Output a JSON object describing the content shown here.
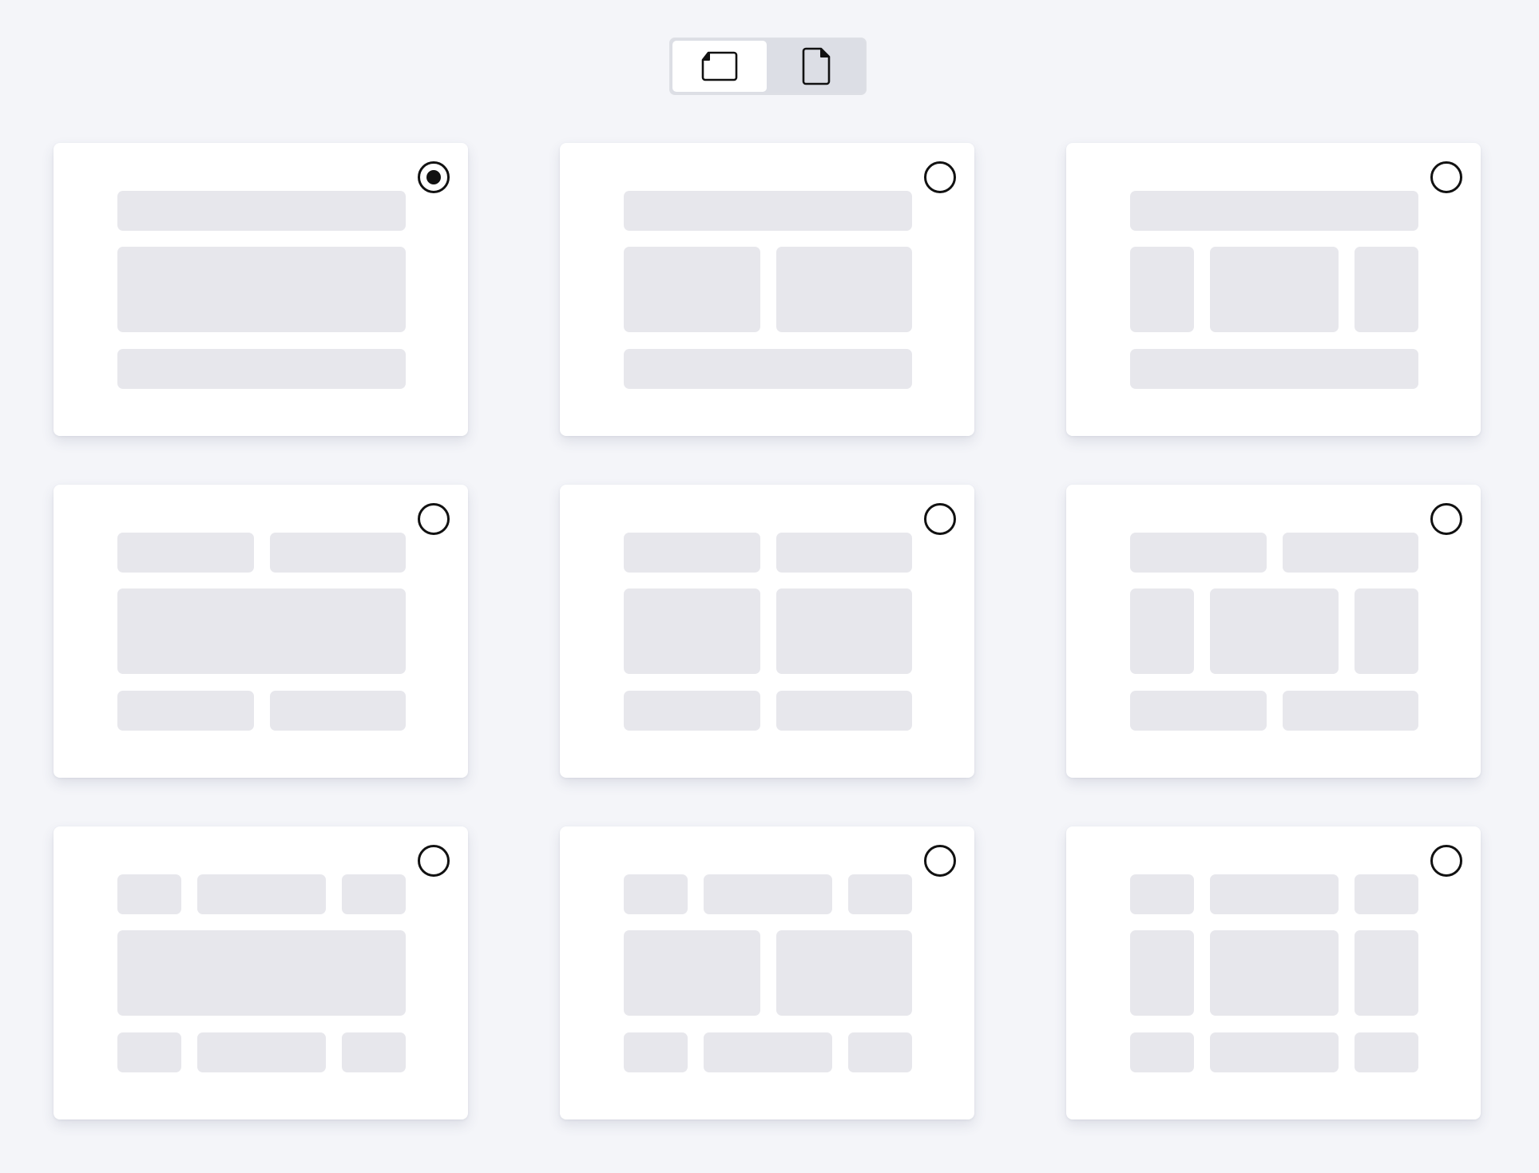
{
  "orientation": {
    "options": [
      {
        "id": "landscape",
        "icon": "landscape-page-icon",
        "selected": true
      },
      {
        "id": "portrait",
        "icon": "portrait-page-icon",
        "selected": false
      }
    ]
  },
  "layouts": [
    {
      "id": "layout-1",
      "header": 1,
      "body": 1,
      "footer": 1,
      "selected": true
    },
    {
      "id": "layout-2",
      "header": 1,
      "body": 2,
      "footer": 1,
      "selected": false
    },
    {
      "id": "layout-3",
      "header": 1,
      "body": 3,
      "footer": 1,
      "selected": false
    },
    {
      "id": "layout-4",
      "header": 2,
      "body": 1,
      "footer": 2,
      "selected": false
    },
    {
      "id": "layout-5",
      "header": 2,
      "body": 2,
      "footer": 2,
      "selected": false
    },
    {
      "id": "layout-6",
      "header": 2,
      "body": 3,
      "footer": 2,
      "selected": false
    },
    {
      "id": "layout-7",
      "header": 3,
      "body": 1,
      "footer": 3,
      "selected": false
    },
    {
      "id": "layout-8",
      "header": 3,
      "body": 2,
      "footer": 3,
      "selected": false
    },
    {
      "id": "layout-9",
      "header": 3,
      "body": 3,
      "footer": 3,
      "selected": false
    }
  ]
}
